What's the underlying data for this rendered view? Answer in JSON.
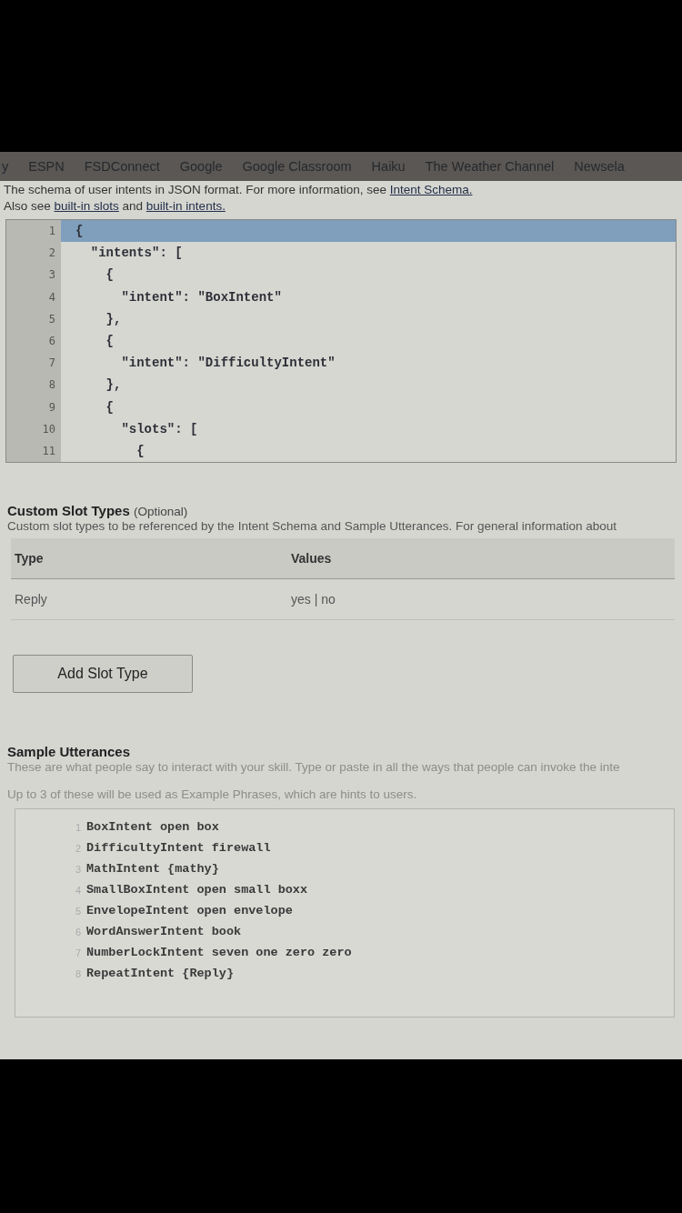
{
  "bookmarks": [
    {
      "label": "y"
    },
    {
      "label": "ESPN"
    },
    {
      "label": "FSDConnect"
    },
    {
      "label": "Google"
    },
    {
      "label": "Google Classroom"
    },
    {
      "label": "Haiku"
    },
    {
      "label": "The Weather Channel"
    },
    {
      "label": "Newsela"
    }
  ],
  "intro": {
    "text": "The schema of user intents in JSON format. For more information, see ",
    "link": "Intent Schema."
  },
  "also": {
    "before": "Also see ",
    "link1": "built-in slots",
    "middle": " and ",
    "link2": "built-in intents."
  },
  "schema_editor": {
    "lines": [
      {
        "number": "1",
        "code": "{",
        "selected": true
      },
      {
        "number": "2",
        "code": "  \"intents\": [",
        "selected": false
      },
      {
        "number": "3",
        "code": "    {",
        "selected": false
      },
      {
        "number": "4",
        "code": "      \"intent\": \"BoxIntent\"",
        "selected": false
      },
      {
        "number": "5",
        "code": "    },",
        "selected": false
      },
      {
        "number": "6",
        "code": "    {",
        "selected": false
      },
      {
        "number": "7",
        "code": "      \"intent\": \"DifficultyIntent\"",
        "selected": false
      },
      {
        "number": "8",
        "code": "    },",
        "selected": false
      },
      {
        "number": "9",
        "code": "    {",
        "selected": false
      },
      {
        "number": "10",
        "code": "      \"slots\": [",
        "selected": false
      },
      {
        "number": "11",
        "code": "        {",
        "selected": false
      }
    ]
  },
  "custom_slot_types": {
    "title": "Custom Slot Types",
    "note": "(Optional)",
    "description": "Custom slot types to be referenced by the Intent Schema and Sample Utterances. For general information about",
    "columns": [
      "Type",
      "Values"
    ],
    "rows": [
      [
        "Reply",
        "yes | no"
      ]
    ],
    "add_button": "Add Slot Type"
  },
  "sample_utterances": {
    "title": "Sample Utterances",
    "description": "These are what people say to interact with your skill. Type or paste in all the ways that people can invoke the inte",
    "hint": "Up to 3 of these will be used as Example Phrases, which are hints to users.",
    "lines": [
      {
        "number": "1",
        "code": "BoxIntent open box"
      },
      {
        "number": "2",
        "code": "DifficultyIntent firewall"
      },
      {
        "number": "3",
        "code": "MathIntent {mathy}"
      },
      {
        "number": "4",
        "code": "SmallBoxIntent open small boxx"
      },
      {
        "number": "5",
        "code": "EnvelopeIntent open envelope"
      },
      {
        "number": "6",
        "code": "WordAnswerIntent book"
      },
      {
        "number": "7",
        "code": "NumberLockIntent seven one zero zero"
      },
      {
        "number": "8",
        "code": "RepeatIntent {Reply}"
      }
    ]
  }
}
